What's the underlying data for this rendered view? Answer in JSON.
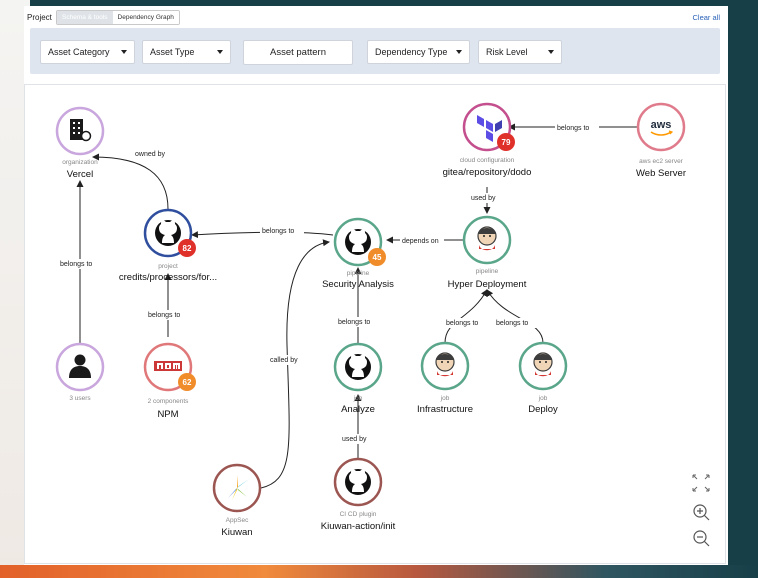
{
  "topbar": {
    "project_label": "Project",
    "tabs": [
      {
        "label": "Schema & tools",
        "active": true
      },
      {
        "label": "Dependency Graph",
        "active": false
      }
    ],
    "clear_all": "Clear all"
  },
  "filters": {
    "asset_category": "Asset Category",
    "asset_type": "Asset Type",
    "asset_pattern_placeholder": "Asset pattern",
    "dependency_type": "Dependency Type",
    "risk_level": "Risk Level"
  },
  "nodes": {
    "vercel": {
      "type": "organization",
      "name": "Vercel",
      "icon": "building-icon"
    },
    "credits": {
      "type": "project",
      "name": "credits/processors/for...",
      "badge": "82",
      "icon": "github-icon"
    },
    "users": {
      "type": "3 users",
      "name": "",
      "icon": "user-icon"
    },
    "npm": {
      "type": "2 components",
      "name": "NPM",
      "badge": "62",
      "icon": "npm-icon"
    },
    "kiuwan_appsec": {
      "type": "AppSec",
      "name": "Kiuwan",
      "icon": "kiuwan-icon"
    },
    "security_analysis": {
      "type": "pipeline",
      "name": "Security Analysis",
      "badge": "45",
      "icon": "github-icon"
    },
    "analyze": {
      "type": "job",
      "name": "Analyze",
      "icon": "github-icon"
    },
    "kiuwan_action": {
      "type": "CI CD plugin",
      "name": "Kiuwan-action/init",
      "icon": "github-icon"
    },
    "gitea": {
      "type": "cloud configuration",
      "name": "gitea/repository/dodo",
      "badge": "79",
      "icon": "terraform-icon"
    },
    "web_server": {
      "type": "aws ec2 server",
      "name": "Web Server",
      "icon": "aws-icon",
      "logo_text": "aws"
    },
    "hyper_deployment": {
      "type": "pipeline",
      "name": "Hyper Deployment",
      "icon": "jenkins-icon"
    },
    "infrastructure": {
      "type": "job",
      "name": "Infrastructure",
      "icon": "jenkins-icon"
    },
    "deploy": {
      "type": "job",
      "name": "Deploy",
      "icon": "jenkins-icon"
    }
  },
  "edges": {
    "owned_by": "owned by",
    "users_belongs_to": "belongs to",
    "npm_belongs_to": "belongs to",
    "sa_belongs_to": "belongs to",
    "called_by": "called by",
    "analyze_belongs_to": "belongs to",
    "used_by_plugin": "used by",
    "depends_on": "depends on",
    "used_by_gitea": "used by",
    "aws_belongs_to": "belongs to",
    "infra_belongs_to": "belongs to",
    "deploy_belongs_to": "belongs to"
  },
  "colors": {
    "ring_org": "#c9a6dd",
    "ring_project": "#2f4f9e",
    "ring_pipeline": "#5aa68a",
    "ring_job": "#5aa68a",
    "ring_plugin": "#9c5652",
    "ring_npm": "#e0787a",
    "ring_user": "#c9a6dd",
    "ring_tf": "#c44f8e",
    "ring_aws": "#e07b8c",
    "badge_red": "#e0302a",
    "badge_orange": "#f08c2a"
  }
}
